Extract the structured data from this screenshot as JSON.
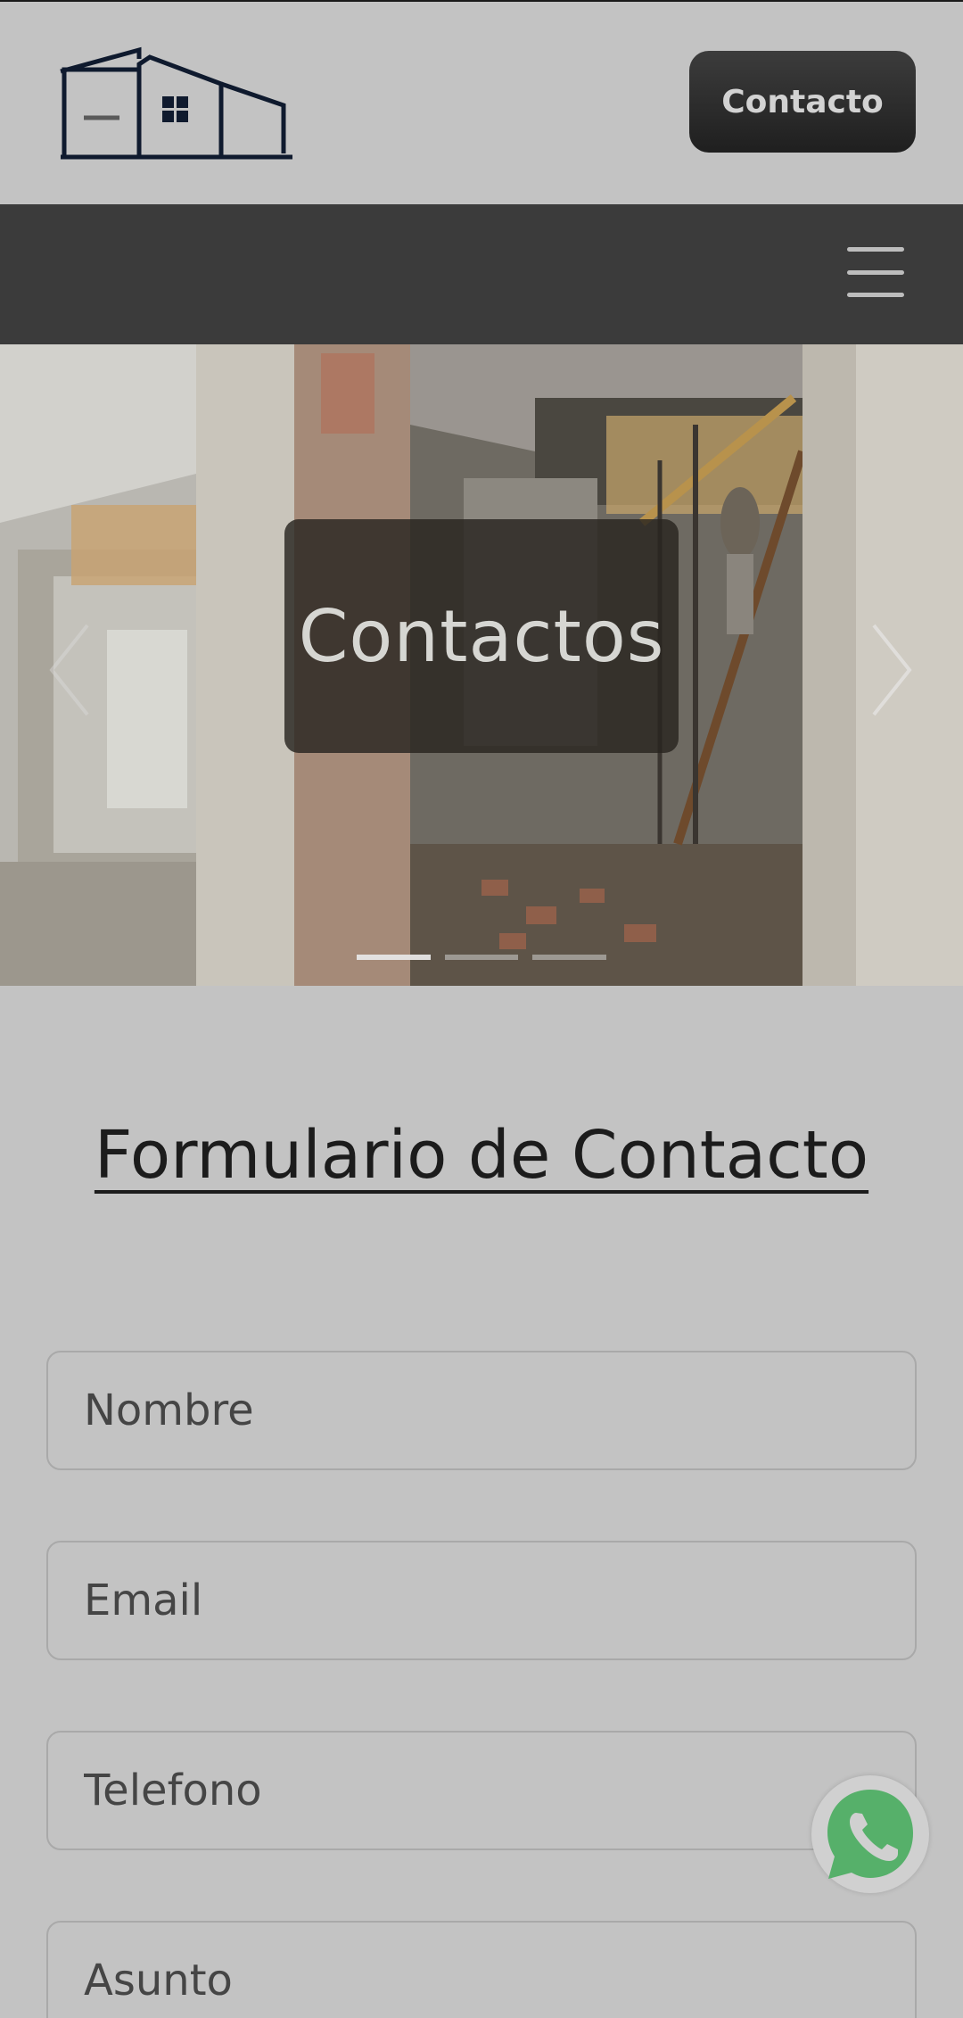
{
  "header": {
    "logo_icon": "house-logo-icon",
    "contact_button_label": "Contacto"
  },
  "nav": {
    "menu_icon": "hamburger-menu-icon"
  },
  "hero": {
    "title": "Contactos",
    "slide_count": 3,
    "active_slide": 1,
    "prev_icon": "chevron-left-icon",
    "next_icon": "chevron-right-icon"
  },
  "form": {
    "title": "Formulario de Contacto",
    "fields": {
      "nombre": {
        "placeholder": "Nombre",
        "value": ""
      },
      "email": {
        "placeholder": "Email",
        "value": ""
      },
      "telefono": {
        "placeholder": "Telefono",
        "value": ""
      },
      "asunto": {
        "placeholder": "Asunto",
        "value": ""
      }
    }
  },
  "whatsapp": {
    "icon": "whatsapp-icon",
    "color": "#25D366"
  },
  "colors": {
    "page_bg": "#c3c3c3",
    "navbar_bg": "#3b3b3b",
    "button_bg": "#2a2a2a",
    "title_text": "#1c1c1c"
  }
}
